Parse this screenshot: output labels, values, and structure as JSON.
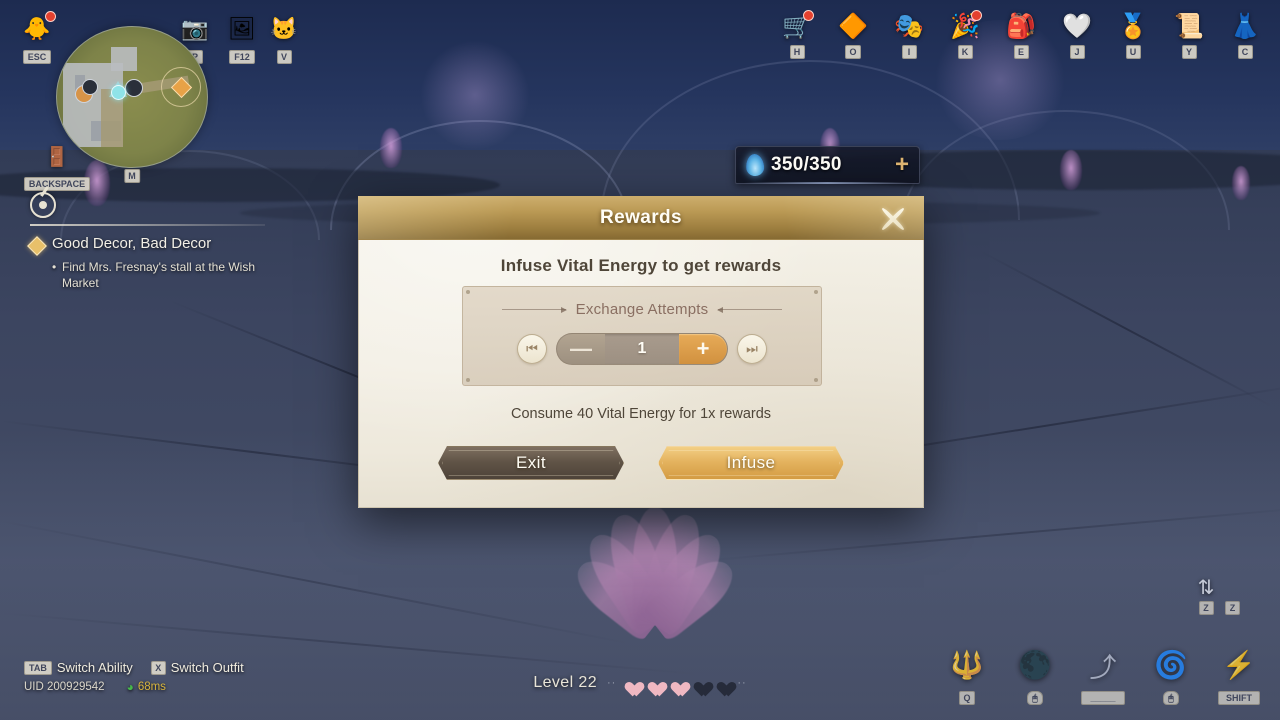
{
  "hud": {
    "top_left_icons": [
      {
        "name": "menu-chick-icon",
        "glyph": "🐥",
        "key": "ESC",
        "badge": true
      },
      {
        "name": "camera-icon",
        "glyph": "📷",
        "key": "P",
        "badge": false
      },
      {
        "name": "screenshot-edit-icon",
        "glyph": "🖼",
        "key": "F12",
        "badge": false
      },
      {
        "name": "pet-cat-icon",
        "glyph": "🐱",
        "key": "V",
        "badge": false
      }
    ],
    "backspace": {
      "label": "BACKSPACE",
      "glyph": "🚪"
    },
    "minimap": {
      "key": "M"
    },
    "top_right_icons": [
      {
        "name": "shop-cart-icon",
        "glyph": "🛒",
        "key": "H",
        "badge": true
      },
      {
        "name": "quest-diamond-icon",
        "glyph": "🔶",
        "key": "O",
        "badge": false
      },
      {
        "name": "character-icon",
        "glyph": "🎭",
        "key": "I",
        "badge": false
      },
      {
        "name": "event-party-icon",
        "glyph": "🎉",
        "key": "K",
        "badge": true
      },
      {
        "name": "bag-icon",
        "glyph": "🎒",
        "key": "E",
        "badge": false
      },
      {
        "name": "friends-heart-icon",
        "glyph": "🤍",
        "key": "J",
        "badge": false
      },
      {
        "name": "achievement-icon",
        "glyph": "🏅",
        "key": "U",
        "badge": false
      },
      {
        "name": "map-scroll-icon",
        "glyph": "📜",
        "key": "Y",
        "badge": false
      },
      {
        "name": "wardrobe-dress-icon",
        "glyph": "👗",
        "key": "C",
        "badge": false
      }
    ],
    "energy": {
      "current": "350/350",
      "plus": "+"
    },
    "quest": {
      "title": "Good Decor, Bad Decor",
      "objective": "Find Mrs. Fresnay's stall at the Wish Market"
    },
    "bottom_hints": [
      {
        "key": "TAB",
        "label": "Switch Ability"
      },
      {
        "key": "X",
        "label": "Switch Outfit"
      }
    ],
    "uid": "UID 200929542",
    "ping": "68ms",
    "level": {
      "label": "Level 22",
      "hearts_filled": 3,
      "hearts_empty": 2
    },
    "abilities": [
      {
        "name": "ability-slot-q",
        "glyph": "🔱",
        "key": "Q"
      },
      {
        "name": "ability-slot-mouse-left",
        "glyph": "🌑",
        "key": "🖱"
      },
      {
        "name": "ability-slot-space",
        "glyph": "⤴",
        "key": "_____"
      },
      {
        "name": "ability-slot-mouse-right",
        "glyph": "🌀",
        "key": "🖱"
      },
      {
        "name": "ability-slot-shift",
        "glyph": "⚡",
        "key": "SHIFT"
      }
    ],
    "z_toggle": {
      "key_left": "Z",
      "key_right": "Z",
      "glyph": "⇅"
    }
  },
  "dialog": {
    "title": "Rewards",
    "subtitle": "Infuse Vital Energy to get rewards",
    "attempts_label": "Exchange Attempts",
    "stepper": {
      "min_glyph": "⏮",
      "minus_glyph": "—",
      "value": "1",
      "plus_glyph": "+",
      "max_glyph": "⏭"
    },
    "consume_note": "Consume 40 Vital Energy for 1x rewards",
    "exit_label": "Exit",
    "infuse_label": "Infuse"
  },
  "colors": {
    "gold": "#d1913f",
    "panel_cream": "#f2eee3",
    "header_gold": "#bb9a55",
    "exit_brown": "#5f5346",
    "energy_blue": "#5eb6e8"
  }
}
